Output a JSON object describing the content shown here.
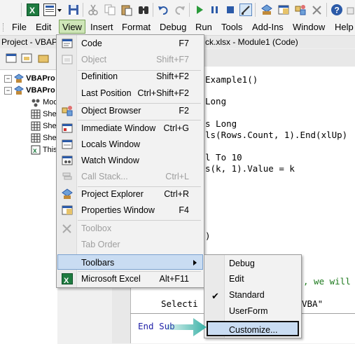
{
  "toolbar": {
    "icons": [
      "excel-icon",
      "view-object-icon",
      "dropdown-icon",
      "save-icon",
      "cut-icon",
      "copy-icon",
      "paste-icon",
      "find-icon",
      "undo-icon",
      "redo-icon",
      "run-icon",
      "break-icon",
      "reset-icon",
      "design-mode-icon",
      "project-explorer-icon",
      "properties-icon",
      "object-browser-icon",
      "toolbox-icon",
      "help-icon"
    ]
  },
  "menubar": {
    "items": [
      "File",
      "Edit",
      "View",
      "Insert",
      "Format",
      "Debug",
      "Run",
      "Tools",
      "Add-Ins",
      "Window",
      "Help"
    ]
  },
  "project_pane": {
    "title": "Project - VBAPr",
    "tree": [
      {
        "label": "VBAPro"
      },
      {
        "label": "VBAPro"
      },
      {
        "label": "Mod"
      },
      {
        "label": "She"
      },
      {
        "label": "She"
      },
      {
        "label": "She"
      },
      {
        "label": "This"
      }
    ]
  },
  "code_window": {
    "title": "ck.xlsx - Module1 (Code)",
    "lines": [
      "Example1()",
      "Long",
      "s Long",
      "ls(Rows.Count, 1).End(xlUp)",
      "l To 10",
      "s(k, 1).Value = k",
      ")",
      ", we will",
      "VBA\"",
      "Selecti",
      "End Sub"
    ]
  },
  "view_menu": {
    "items": [
      {
        "label": "Code",
        "shortcut": "F7",
        "icon": "code-icon"
      },
      {
        "label": "Object",
        "shortcut": "Shift+F7",
        "icon": "object-icon"
      },
      {
        "label": "Definition",
        "shortcut": "Shift+F2"
      },
      {
        "label": "Last Position",
        "shortcut": "Ctrl+Shift+F2"
      },
      {
        "label": "Object Browser",
        "shortcut": "F2",
        "icon": "object-browser-icon"
      },
      {
        "label": "Immediate Window",
        "shortcut": "Ctrl+G",
        "icon": "immediate-window-icon"
      },
      {
        "label": "Locals Window",
        "shortcut": "",
        "icon": "locals-window-icon"
      },
      {
        "label": "Watch Window",
        "shortcut": "",
        "icon": "watch-window-icon"
      },
      {
        "label": "Call Stack...",
        "shortcut": "Ctrl+L",
        "icon": "call-stack-icon"
      },
      {
        "label": "Project Explorer",
        "shortcut": "Ctrl+R",
        "icon": "project-explorer-icon"
      },
      {
        "label": "Properties Window",
        "shortcut": "F4",
        "icon": "properties-window-icon"
      },
      {
        "label": "Toolbox",
        "shortcut": "",
        "icon": "toolbox-icon"
      },
      {
        "label": "Tab Order",
        "shortcut": ""
      },
      {
        "label": "Toolbars",
        "shortcut": ""
      },
      {
        "label": "Microsoft Excel",
        "shortcut": "Alt+F11",
        "icon": "excel-icon"
      }
    ]
  },
  "toolbars_submenu": {
    "items": [
      {
        "label": "Debug",
        "checked": false
      },
      {
        "label": "Edit",
        "checked": false
      },
      {
        "label": "Standard",
        "checked": true
      },
      {
        "label": "UserForm",
        "checked": false
      },
      {
        "label": "Customize...",
        "checked": false
      }
    ],
    "check_glyph": "✔"
  },
  "colors": {
    "accent_teal": "#38b1a6",
    "menu_highlight": "#c9dcf2",
    "view_menu_active": "#cfe6b8"
  }
}
